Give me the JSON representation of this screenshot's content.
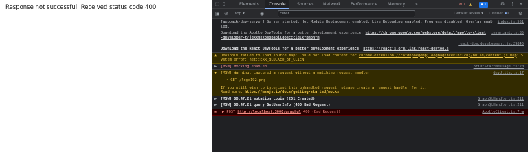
{
  "app": {
    "error_message": "Response not successful: Received status code 400"
  },
  "devtools": {
    "tabs": [
      "Elements",
      "Console",
      "Sources",
      "Network",
      "Performance",
      "Memory"
    ],
    "more_tabs": "»",
    "badges": {
      "errors": "1",
      "warnings": "1",
      "messages": "1"
    },
    "toolbar": {
      "context": "top",
      "filter_placeholder": "Filter",
      "levels": "Default levels",
      "issues": "1 Issue:",
      "issues_count": "1"
    },
    "log": [
      {
        "text": "[webpack-dev-server] Server started: Hot Module Replacement enabled, Live Reloading enabled, Progress disabled, Overlay enabled.",
        "source": "index.js:551"
      },
      {
        "text": "Download the Apollo DevTools for a better development experience: ",
        "link": "https://chrome.google.com/webstore/detail/apollo-client-developer-t/jdkknkkbebbapilgoeccciglkfbmbnfm",
        "source": "invariant.ts:85"
      },
      {
        "source": "react-dom.development.js:29840",
        "text": "Download the React DevTools for a better development experience: ",
        "link": "https://reactjs.org/link/react-devtools"
      },
      {
        "level": "warning",
        "text": "DevTools failed to load source map: Could not load content for ",
        "link": "chrome-extension://cofdbpoegempjloogbagkncekinflcnj/build/content.js.map",
        "text_after": ": System error: net::ERR_BLOCKED_BY_CLIENT"
      },
      {
        "prefix": "▶",
        "text": "[MSW] Mocking enabled.",
        "source": "printStartMessage.ts:20"
      },
      {
        "level": "warning",
        "prefix": "▼",
        "text": "[MSW] Warning: captured a request without a matching request handler:",
        "source": "devUtils.ts:17",
        "bullet": "• GET /logo192.png",
        "hint": "If you still wish to intercept this unhandled request, please create a request handler for it.",
        "read_more": "Read more: ",
        "read_more_link": "https://mswjs.io/docs/getting-started/mocks"
      },
      {
        "prefix": "▶",
        "text": "[MSW] 00:47:21 mutation Login (",
        "status": "201 Created",
        "text_after": ")",
        "source": "GraphQLHandler.ts:211"
      },
      {
        "prefix": "▶",
        "text": "[MSW] 00:47:21 query GetUserInfo (",
        "status": "400 Bad Request",
        "text_after": ")",
        "source": "GraphQLHandler.ts:211"
      },
      {
        "level": "error",
        "prefix": "▶",
        "text": "POST ",
        "link": "http://localhost:3000/graphql",
        "status": "400 (Bad Request)",
        "source": "ApolloClient.ts:7"
      }
    ]
  }
}
